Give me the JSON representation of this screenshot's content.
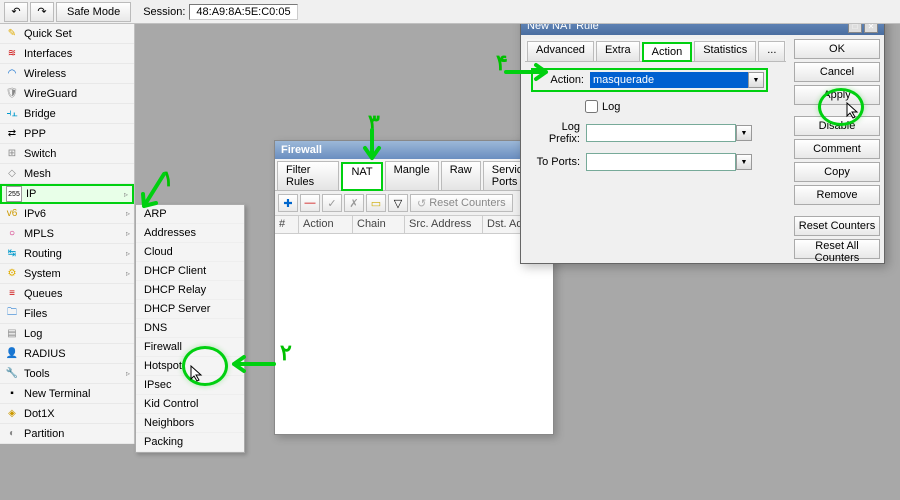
{
  "topbar": {
    "safemode_label": "Safe Mode",
    "session_label": "Session:",
    "session_value": "48:A9:8A:5E:C0:05"
  },
  "sidebar": {
    "items": [
      {
        "icon": "✎",
        "cl": "ic-quickset",
        "label": "Quick Set"
      },
      {
        "icon": "≋",
        "cl": "ic-if",
        "label": "Interfaces"
      },
      {
        "icon": "◠",
        "cl": "ic-wifi",
        "label": "Wireless"
      },
      {
        "icon": "🛡",
        "cl": "ic-wg",
        "label": "WireGuard"
      },
      {
        "icon": "⫞⫠",
        "cl": "ic-bridge",
        "label": "Bridge"
      },
      {
        "icon": "⇄",
        "cl": "ic-ppp",
        "label": "PPP"
      },
      {
        "icon": "⊞",
        "cl": "ic-switch",
        "label": "Switch"
      },
      {
        "icon": "◇",
        "cl": "ic-mesh",
        "label": "Mesh"
      },
      {
        "icon": "255",
        "cl": "ic-ip",
        "label": "IP",
        "sub": true,
        "hl": true
      },
      {
        "icon": "v6",
        "cl": "ic-ipv6",
        "label": "IPv6",
        "sub": true
      },
      {
        "icon": "○",
        "cl": "ic-mpls",
        "label": "MPLS",
        "sub": true
      },
      {
        "icon": "↹",
        "cl": "ic-routing",
        "label": "Routing",
        "sub": true
      },
      {
        "icon": "⚙",
        "cl": "ic-system",
        "label": "System",
        "sub": true
      },
      {
        "icon": "≡",
        "cl": "ic-queues",
        "label": "Queues"
      },
      {
        "icon": "🗀",
        "cl": "ic-files",
        "label": "Files"
      },
      {
        "icon": "▤",
        "cl": "ic-log",
        "label": "Log"
      },
      {
        "icon": "👤",
        "cl": "ic-radius",
        "label": "RADIUS"
      },
      {
        "icon": "🔧",
        "cl": "ic-tools",
        "label": "Tools",
        "sub": true
      },
      {
        "icon": "▪",
        "cl": "ic-term",
        "label": "New Terminal"
      },
      {
        "icon": "◈",
        "cl": "ic-dot1x",
        "label": "Dot1X"
      },
      {
        "icon": "◐",
        "cl": "ic-part",
        "label": "Partition"
      }
    ]
  },
  "submenu": {
    "items": [
      "ARP",
      "Addresses",
      "Cloud",
      "DHCP Client",
      "DHCP Relay",
      "DHCP Server",
      "DNS",
      "Firewall",
      "Hotspot",
      "IPsec",
      "Kid Control",
      "Neighbors",
      "Packing"
    ]
  },
  "firewall": {
    "title": "Firewall",
    "tabs": [
      "Filter Rules",
      "NAT",
      "Mangle",
      "Raw",
      "Service Ports"
    ],
    "active_tab": 1,
    "reset_label": "Reset Counters",
    "toolbar_plus": "✚",
    "toolbar_minus": "—",
    "toolbar_check": "✓",
    "toolbar_x": "✗",
    "toolbar_note": "▭",
    "toolbar_filter": "▽",
    "cols": [
      "#",
      "Action",
      "Chain",
      "Src. Address",
      "Dst. Ad"
    ]
  },
  "nat": {
    "title": "New NAT Rule",
    "tabs": [
      "Advanced",
      "Extra",
      "Action",
      "Statistics",
      "..."
    ],
    "active_tab": 2,
    "action_label": "Action:",
    "action_value": "masquerade",
    "log_label": "Log",
    "logprefix_label": "Log Prefix:",
    "toports_label": "To Ports:",
    "buttons": [
      "OK",
      "Cancel",
      "Apply",
      "Disable",
      "Comment",
      "Copy",
      "Remove",
      "Reset Counters",
      "Reset All Counters"
    ]
  },
  "annotations": {
    "n1": "۱",
    "n2": "۲",
    "n3": "۳",
    "n4": "۴"
  }
}
